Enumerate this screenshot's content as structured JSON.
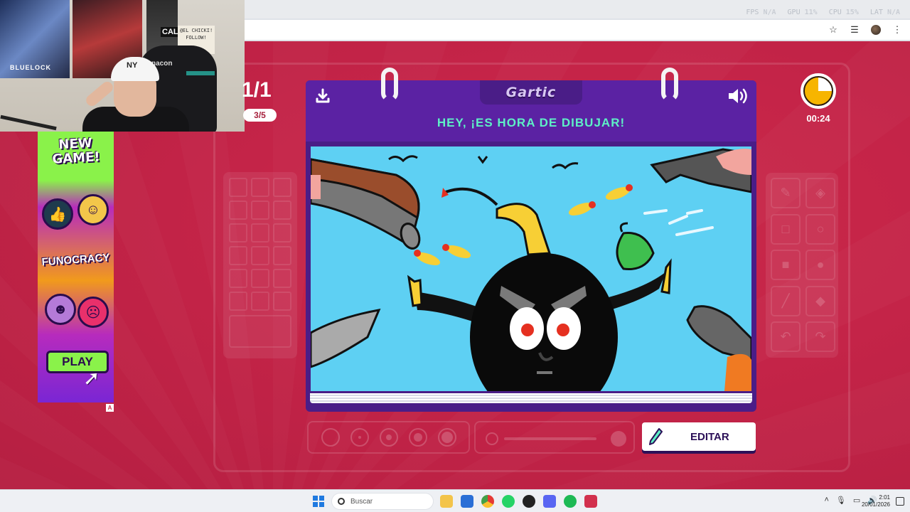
{
  "browser": {
    "perf_overlay": [
      {
        "label": "FPS",
        "value": "N/A"
      },
      {
        "label": "GPU",
        "value": "11%"
      },
      {
        "label": "CPU",
        "value": "15%"
      },
      {
        "label": "LAT",
        "value": "N/A"
      }
    ],
    "toolbar_icons": [
      "star-icon",
      "media-control-icon",
      "profile-avatar",
      "kebab-menu-icon"
    ]
  },
  "webcam": {
    "poster_text": "BLUELOCK",
    "poster2_text": "CAL",
    "note_text": "@EL CHICKI! FOLLOW!",
    "chair_brand": "nacon",
    "cap_logo": "NY"
  },
  "ad": {
    "headline": "NEW GAME!",
    "brand": "FUNOCRACY",
    "play_label": "PLAY",
    "badge": "A"
  },
  "game": {
    "round_text": "1/1",
    "turn_pill": "3/5",
    "logo": "Gartic",
    "headline": "HEY, ¡ES HORA DE DIBUJAR!",
    "timer": {
      "label": "00:24",
      "remaining_fraction": 0.75,
      "color": "#f7b500"
    },
    "edit_button": "EDITAR",
    "palette_slots": 18,
    "tools": [
      "pencil-icon",
      "eraser-icon",
      "rect-outline-icon",
      "circle-outline-icon",
      "rect-fill-icon",
      "circle-fill-icon",
      "line-icon",
      "bucket-icon",
      "undo-icon",
      "redo-icon"
    ],
    "brush_sizes": 5,
    "colors": {
      "accent": "#5ef0c6",
      "book": "#4a1d87",
      "background": "#c92a4a",
      "canvas": "#5ed0f3"
    }
  },
  "taskbar": {
    "search_placeholder": "Buscar",
    "time": "2:01",
    "date": "20/01/2026"
  }
}
